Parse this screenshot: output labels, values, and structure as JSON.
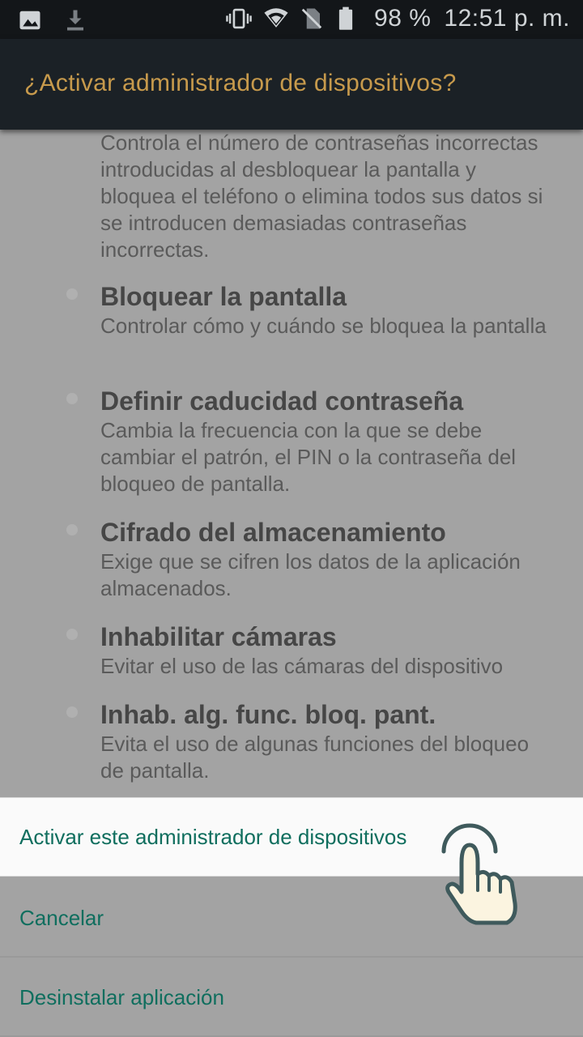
{
  "status_bar": {
    "battery_text": "98 %",
    "time": "12:51 p. m.",
    "icons": [
      "image-icon",
      "download-icon",
      "vibrate-icon",
      "wifi-icon",
      "no-sim-icon",
      "battery-icon"
    ]
  },
  "app_bar": {
    "title": "¿Activar administrador de dispositivos?"
  },
  "intro": {
    "description": "Controla el número de contraseñas incorrectas introducidas al desbloquear la pantalla y bloquea el teléfono o elimina todos sus datos si se introducen demasiadas contraseñas incorrectas."
  },
  "permissions": [
    {
      "title": "Bloquear la pantalla",
      "desc": "Controlar cómo y cuándo se bloquea la pantalla"
    },
    {
      "title": "Definir caducidad contraseña",
      "desc": "Cambia la frecuencia con la que se debe cambiar el patrón, el PIN o la contraseña del bloqueo de pantalla."
    },
    {
      "title": "Cifrado del almacenamiento",
      "desc": "Exige que se cifren los datos de la aplicación almacenados."
    },
    {
      "title": "Inhabilitar cámaras",
      "desc": "Evitar el uso de las cámaras del dispositivo"
    },
    {
      "title": "Inhab. alg. func. bloq. pant.",
      "desc": "Evita el uso de algunas funciones del bloqueo de pantalla."
    }
  ],
  "actions": {
    "activate": "Activar este administrador de dispositivos",
    "cancel": "Cancelar",
    "uninstall": "Desinstalar aplicación"
  },
  "colors": {
    "accent": "#c79a4c",
    "action_text": "#0f6e5e"
  }
}
